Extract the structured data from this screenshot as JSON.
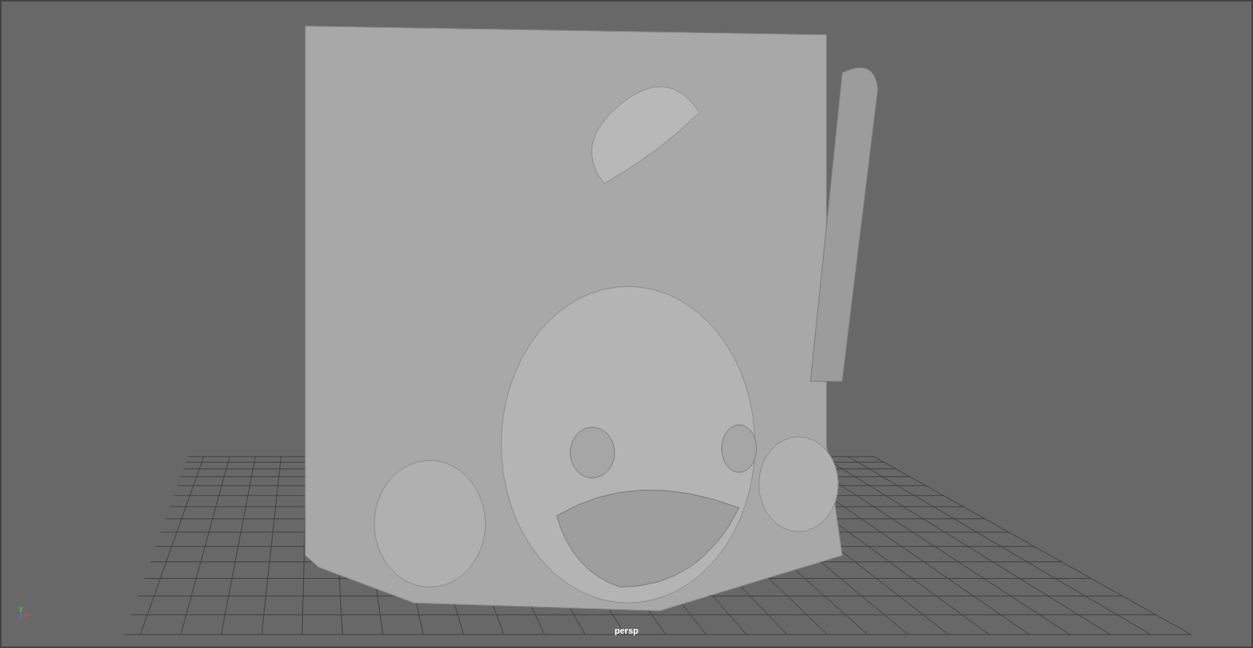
{
  "viewport": {
    "camera_label": "persp"
  },
  "axis_indicator": {
    "axes": [
      {
        "label": "y",
        "color": "#3ccf3c"
      },
      {
        "label": "z",
        "color": "#3c7cff"
      },
      {
        "label": "x",
        "color": "#ff3c3c"
      }
    ]
  }
}
